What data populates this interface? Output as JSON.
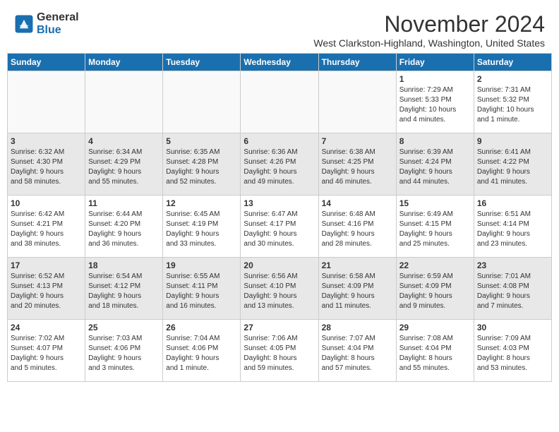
{
  "header": {
    "logo_line1": "General",
    "logo_line2": "Blue",
    "month": "November 2024",
    "location": "West Clarkston-Highland, Washington, United States"
  },
  "weekdays": [
    "Sunday",
    "Monday",
    "Tuesday",
    "Wednesday",
    "Thursday",
    "Friday",
    "Saturday"
  ],
  "weeks": [
    [
      {
        "day": "",
        "detail": ""
      },
      {
        "day": "",
        "detail": ""
      },
      {
        "day": "",
        "detail": ""
      },
      {
        "day": "",
        "detail": ""
      },
      {
        "day": "",
        "detail": ""
      },
      {
        "day": "1",
        "detail": "Sunrise: 7:29 AM\nSunset: 5:33 PM\nDaylight: 10 hours\nand 4 minutes."
      },
      {
        "day": "2",
        "detail": "Sunrise: 7:31 AM\nSunset: 5:32 PM\nDaylight: 10 hours\nand 1 minute."
      }
    ],
    [
      {
        "day": "3",
        "detail": "Sunrise: 6:32 AM\nSunset: 4:30 PM\nDaylight: 9 hours\nand 58 minutes."
      },
      {
        "day": "4",
        "detail": "Sunrise: 6:34 AM\nSunset: 4:29 PM\nDaylight: 9 hours\nand 55 minutes."
      },
      {
        "day": "5",
        "detail": "Sunrise: 6:35 AM\nSunset: 4:28 PM\nDaylight: 9 hours\nand 52 minutes."
      },
      {
        "day": "6",
        "detail": "Sunrise: 6:36 AM\nSunset: 4:26 PM\nDaylight: 9 hours\nand 49 minutes."
      },
      {
        "day": "7",
        "detail": "Sunrise: 6:38 AM\nSunset: 4:25 PM\nDaylight: 9 hours\nand 46 minutes."
      },
      {
        "day": "8",
        "detail": "Sunrise: 6:39 AM\nSunset: 4:24 PM\nDaylight: 9 hours\nand 44 minutes."
      },
      {
        "day": "9",
        "detail": "Sunrise: 6:41 AM\nSunset: 4:22 PM\nDaylight: 9 hours\nand 41 minutes."
      }
    ],
    [
      {
        "day": "10",
        "detail": "Sunrise: 6:42 AM\nSunset: 4:21 PM\nDaylight: 9 hours\nand 38 minutes."
      },
      {
        "day": "11",
        "detail": "Sunrise: 6:44 AM\nSunset: 4:20 PM\nDaylight: 9 hours\nand 36 minutes."
      },
      {
        "day": "12",
        "detail": "Sunrise: 6:45 AM\nSunset: 4:19 PM\nDaylight: 9 hours\nand 33 minutes."
      },
      {
        "day": "13",
        "detail": "Sunrise: 6:47 AM\nSunset: 4:17 PM\nDaylight: 9 hours\nand 30 minutes."
      },
      {
        "day": "14",
        "detail": "Sunrise: 6:48 AM\nSunset: 4:16 PM\nDaylight: 9 hours\nand 28 minutes."
      },
      {
        "day": "15",
        "detail": "Sunrise: 6:49 AM\nSunset: 4:15 PM\nDaylight: 9 hours\nand 25 minutes."
      },
      {
        "day": "16",
        "detail": "Sunrise: 6:51 AM\nSunset: 4:14 PM\nDaylight: 9 hours\nand 23 minutes."
      }
    ],
    [
      {
        "day": "17",
        "detail": "Sunrise: 6:52 AM\nSunset: 4:13 PM\nDaylight: 9 hours\nand 20 minutes."
      },
      {
        "day": "18",
        "detail": "Sunrise: 6:54 AM\nSunset: 4:12 PM\nDaylight: 9 hours\nand 18 minutes."
      },
      {
        "day": "19",
        "detail": "Sunrise: 6:55 AM\nSunset: 4:11 PM\nDaylight: 9 hours\nand 16 minutes."
      },
      {
        "day": "20",
        "detail": "Sunrise: 6:56 AM\nSunset: 4:10 PM\nDaylight: 9 hours\nand 13 minutes."
      },
      {
        "day": "21",
        "detail": "Sunrise: 6:58 AM\nSunset: 4:09 PM\nDaylight: 9 hours\nand 11 minutes."
      },
      {
        "day": "22",
        "detail": "Sunrise: 6:59 AM\nSunset: 4:09 PM\nDaylight: 9 hours\nand 9 minutes."
      },
      {
        "day": "23",
        "detail": "Sunrise: 7:01 AM\nSunset: 4:08 PM\nDaylight: 9 hours\nand 7 minutes."
      }
    ],
    [
      {
        "day": "24",
        "detail": "Sunrise: 7:02 AM\nSunset: 4:07 PM\nDaylight: 9 hours\nand 5 minutes."
      },
      {
        "day": "25",
        "detail": "Sunrise: 7:03 AM\nSunset: 4:06 PM\nDaylight: 9 hours\nand 3 minutes."
      },
      {
        "day": "26",
        "detail": "Sunrise: 7:04 AM\nSunset: 4:06 PM\nDaylight: 9 hours\nand 1 minute."
      },
      {
        "day": "27",
        "detail": "Sunrise: 7:06 AM\nSunset: 4:05 PM\nDaylight: 8 hours\nand 59 minutes."
      },
      {
        "day": "28",
        "detail": "Sunrise: 7:07 AM\nSunset: 4:04 PM\nDaylight: 8 hours\nand 57 minutes."
      },
      {
        "day": "29",
        "detail": "Sunrise: 7:08 AM\nSunset: 4:04 PM\nDaylight: 8 hours\nand 55 minutes."
      },
      {
        "day": "30",
        "detail": "Sunrise: 7:09 AM\nSunset: 4:03 PM\nDaylight: 8 hours\nand 53 minutes."
      }
    ]
  ]
}
